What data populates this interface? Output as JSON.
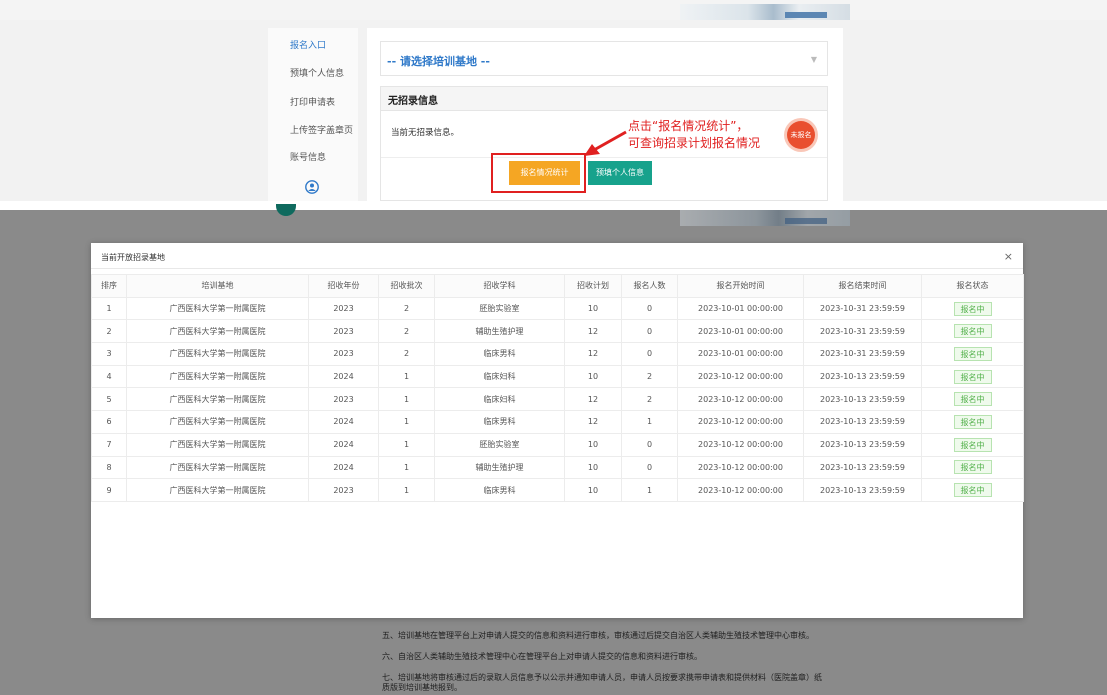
{
  "top": {
    "sidebar": {
      "items": [
        "报名入口",
        "预填个人信息",
        "打印申请表",
        "上传签字盖章页",
        "账号信息"
      ],
      "active_index": 0
    },
    "select": {
      "value": "-- 请选择培训基地 --"
    },
    "card": {
      "title": "无招录信息",
      "body": "当前无招录信息。",
      "stats_button": "报名情况统计",
      "prefill_button": "预填个人信息"
    },
    "annotation": {
      "line1": "点击“报名情况统计”，",
      "line2": "可查询招录计划报名情况"
    },
    "badge": "未报名"
  },
  "modal": {
    "title": "当前开放招录基地",
    "close": "×",
    "columns": [
      "排序",
      "培训基地",
      "招收年份",
      "招收批次",
      "招收学科",
      "招收计划",
      "报名人数",
      "报名开始时间",
      "报名结束时间",
      "报名状态"
    ],
    "rows": [
      [
        "1",
        "广西医科大学第一附属医院",
        "2023",
        "2",
        "胚胎实验室",
        "10",
        "0",
        "2023-10-01 00:00:00",
        "2023-10-31 23:59:59",
        "报名中"
      ],
      [
        "2",
        "广西医科大学第一附属医院",
        "2023",
        "2",
        "辅助生殖护理",
        "12",
        "0",
        "2023-10-01 00:00:00",
        "2023-10-31 23:59:59",
        "报名中"
      ],
      [
        "3",
        "广西医科大学第一附属医院",
        "2023",
        "2",
        "临床男科",
        "12",
        "0",
        "2023-10-01 00:00:00",
        "2023-10-31 23:59:59",
        "报名中"
      ],
      [
        "4",
        "广西医科大学第一附属医院",
        "2024",
        "1",
        "临床妇科",
        "10",
        "2",
        "2023-10-12 00:00:00",
        "2023-10-13 23:59:59",
        "报名中"
      ],
      [
        "5",
        "广西医科大学第一附属医院",
        "2023",
        "1",
        "临床妇科",
        "12",
        "2",
        "2023-10-12 00:00:00",
        "2023-10-13 23:59:59",
        "报名中"
      ],
      [
        "6",
        "广西医科大学第一附属医院",
        "2024",
        "1",
        "临床男科",
        "12",
        "1",
        "2023-10-12 00:00:00",
        "2023-10-13 23:59:59",
        "报名中"
      ],
      [
        "7",
        "广西医科大学第一附属医院",
        "2024",
        "1",
        "胚胎实验室",
        "10",
        "0",
        "2023-10-12 00:00:00",
        "2023-10-13 23:59:59",
        "报名中"
      ],
      [
        "8",
        "广西医科大学第一附属医院",
        "2024",
        "1",
        "辅助生殖护理",
        "10",
        "0",
        "2023-10-12 00:00:00",
        "2023-10-13 23:59:59",
        "报名中"
      ],
      [
        "9",
        "广西医科大学第一附属医院",
        "2023",
        "1",
        "临床男科",
        "10",
        "1",
        "2023-10-12 00:00:00",
        "2023-10-13 23:59:59",
        "报名中"
      ]
    ]
  },
  "underlying_text": [
    "五、培训基地在管理平台上对申请人提交的信息和资料进行审核，审核通过后提交自治区人类辅助生殖技术管理中心审核。",
    "六、自治区人类辅助生殖技术管理中心在管理平台上对申请人提交的信息和资料进行审核。",
    "七、培训基地将审核通过后的录取人员信息予以公示并通知申请人员，申请人员按要求携带申请表和提供材料（医院盖章）纸",
    "质版到培训基地报到。"
  ],
  "colors": {
    "accent_blue": "#2f79c9",
    "stats_button": "#f5a623",
    "prefill_button": "#17a28c",
    "annotation_red": "#e02020",
    "badge": "#e94f2f",
    "status_green": "#52b04a"
  }
}
